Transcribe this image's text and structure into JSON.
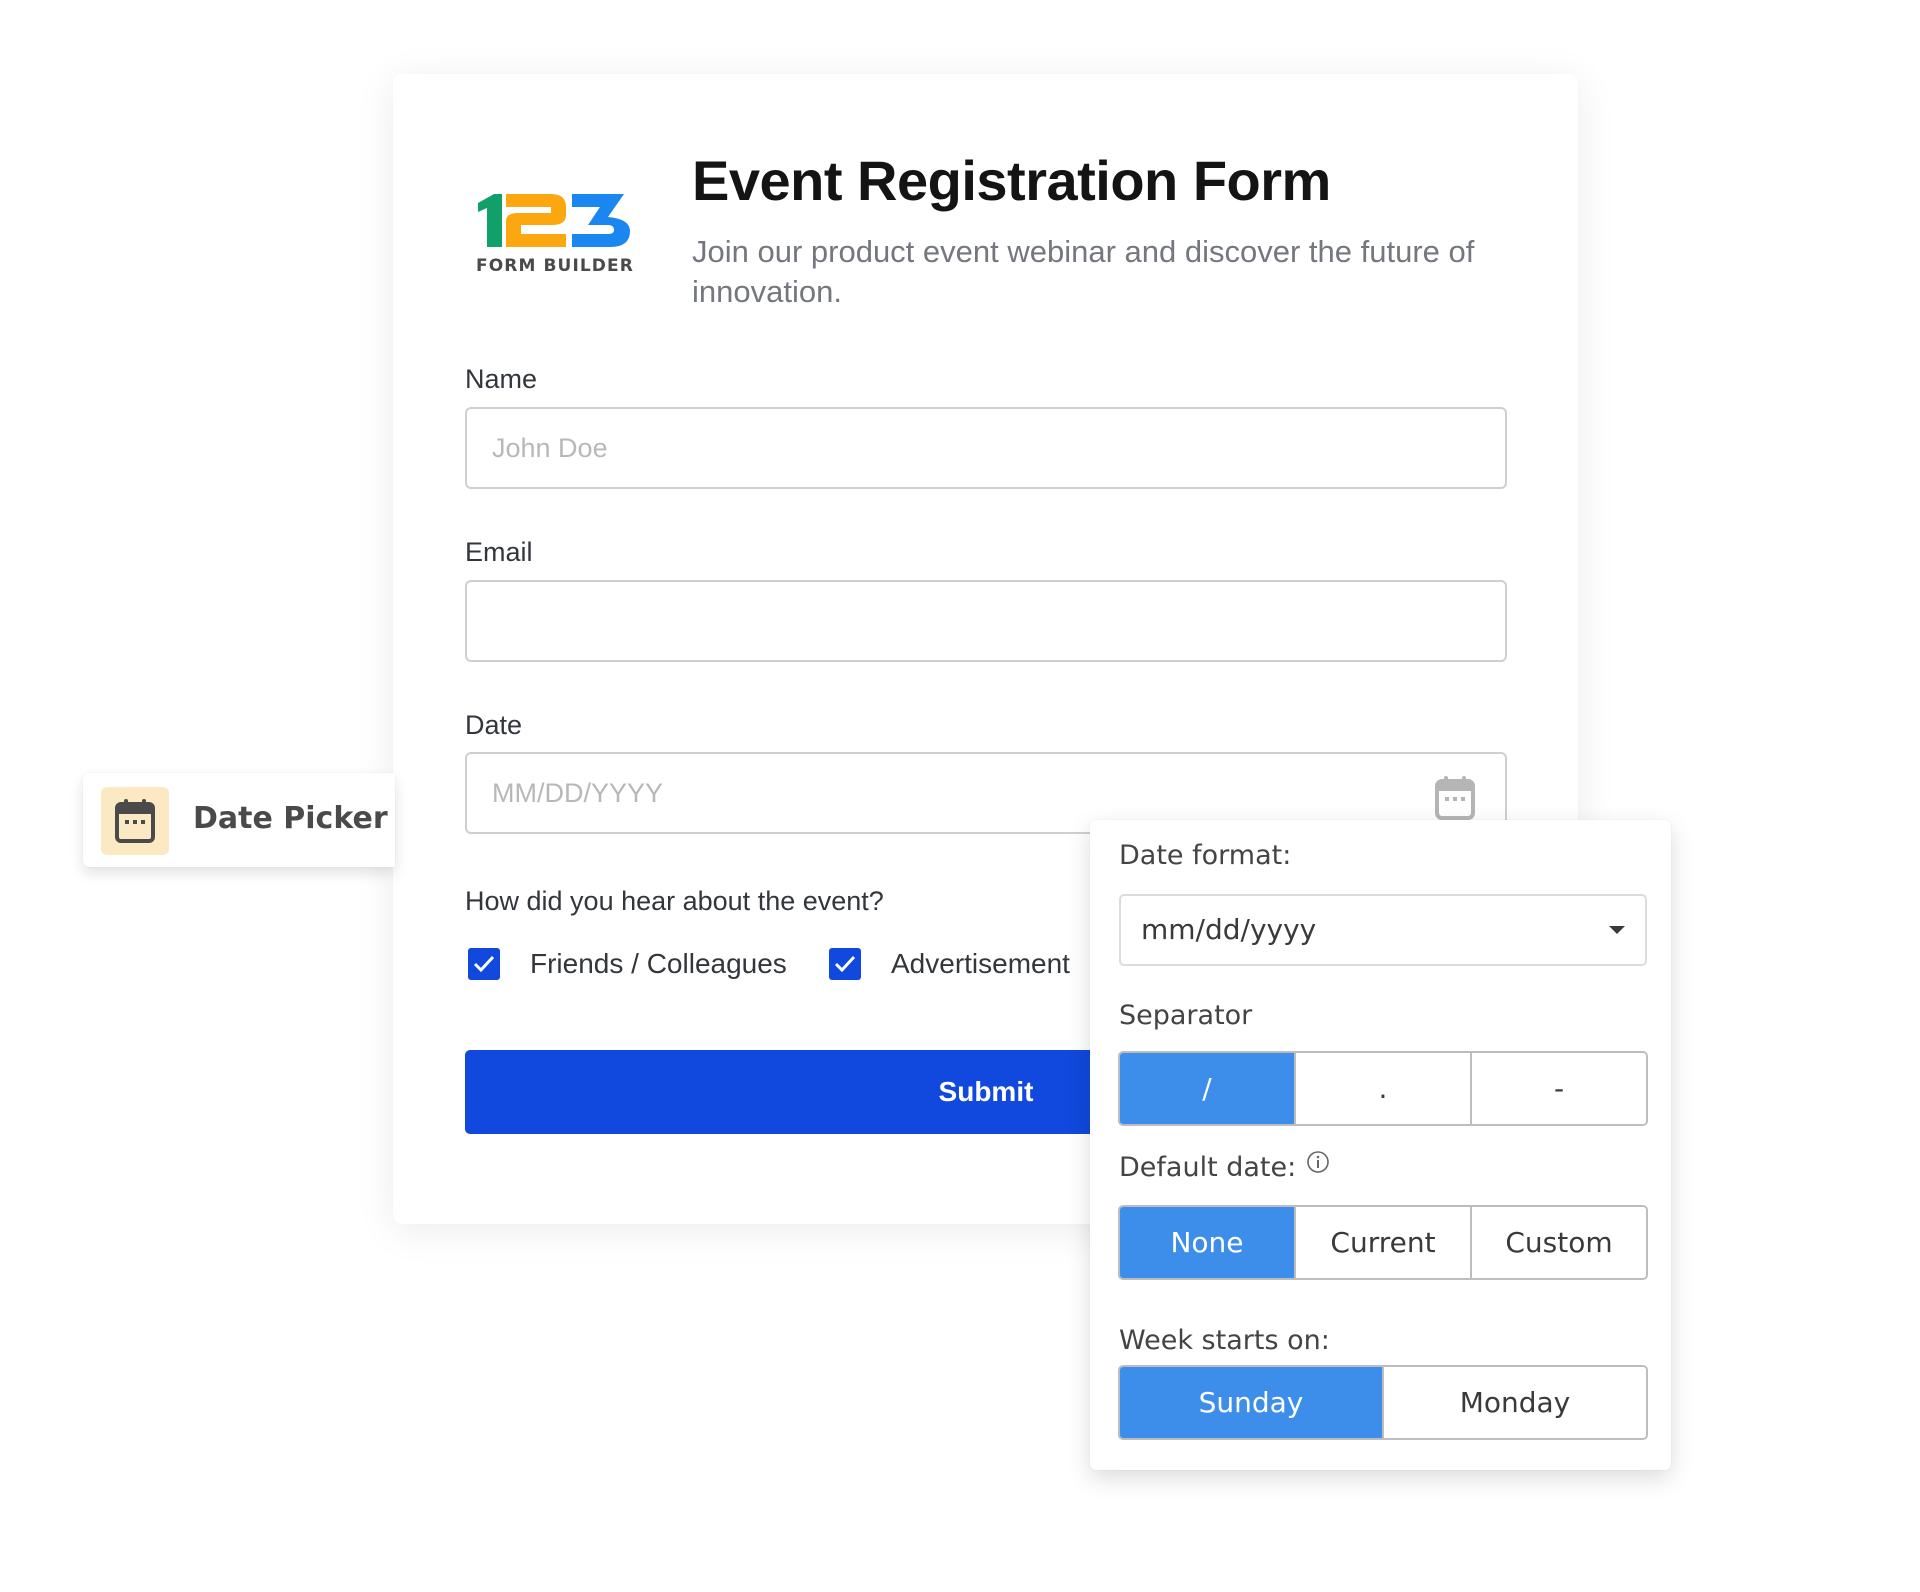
{
  "logo": {
    "digits": [
      "1",
      "2",
      "3"
    ],
    "wordmark": "FORM BUILDER",
    "colors": {
      "one": "#11a06a",
      "two": "#fba70f",
      "three": "#1a86f0"
    }
  },
  "form": {
    "title": "Event Registration Form",
    "subtitle": "Join our product event webinar and discover the future of innovation.",
    "fields": {
      "name": {
        "label": "Name",
        "placeholder": "John Doe",
        "value": ""
      },
      "email": {
        "label": "Email",
        "placeholder": "",
        "value": ""
      },
      "date": {
        "label": "Date",
        "placeholder": "MM/DD/YYYY",
        "value": "",
        "icon": "calendar-icon"
      }
    },
    "question": {
      "label": "How did you hear about the event?",
      "options": [
        {
          "label": "Friends / Colleagues",
          "checked": true
        },
        {
          "label": "Advertisement",
          "checked": true
        }
      ]
    },
    "submit_label": "Submit"
  },
  "tag": {
    "icon": "calendar-icon",
    "label": "Date Picker"
  },
  "settings": {
    "date_format": {
      "label": "Date format:",
      "selected": "mm/dd/yyyy"
    },
    "separator": {
      "label": "Separator",
      "options": [
        "/",
        ".",
        "-"
      ],
      "selected": "/"
    },
    "default_date": {
      "label": "Default date:",
      "info_icon": "info-icon",
      "options": [
        "None",
        "Current",
        "Custom"
      ],
      "selected": "None"
    },
    "week_start": {
      "label": "Week starts on:",
      "options": [
        "Sunday",
        "Monday"
      ],
      "selected": "Sunday"
    }
  },
  "colors": {
    "primary": "#1149de",
    "segment_active": "#3d8eea",
    "tag_icon_bg": "#fbe9c3"
  }
}
